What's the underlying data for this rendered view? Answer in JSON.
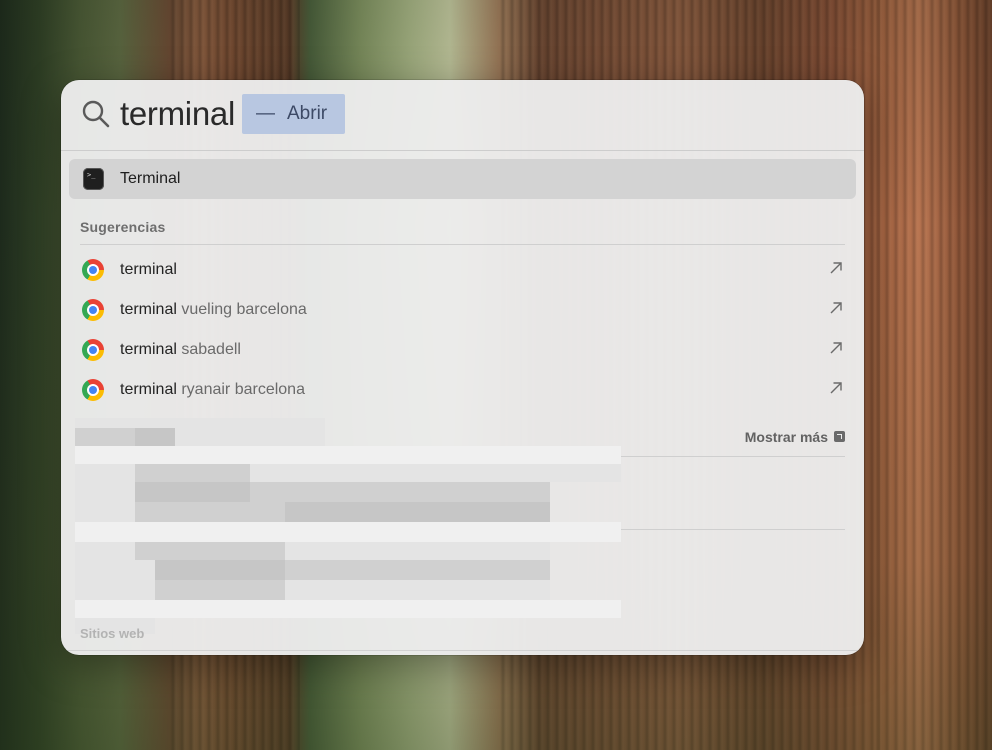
{
  "spotlight": {
    "query": "terminal",
    "open_hint": {
      "dash": "—",
      "label": "Abrir"
    },
    "top_hit": {
      "label": "Terminal",
      "icon": "terminal-app-icon"
    },
    "suggestions_section": {
      "title": "Sugerencias",
      "items": [
        {
          "query": "terminal",
          "rest": "",
          "icon": "chrome-icon"
        },
        {
          "query": "terminal",
          "rest": " vueling barcelona",
          "icon": "chrome-icon"
        },
        {
          "query": "terminal",
          "rest": " sabadell",
          "icon": "chrome-icon"
        },
        {
          "query": "terminal",
          "rest": " ryanair barcelona",
          "icon": "chrome-icon"
        }
      ]
    },
    "more": {
      "label": "Mostrar más"
    },
    "bottom_section": {
      "title": "Sitios web"
    }
  }
}
